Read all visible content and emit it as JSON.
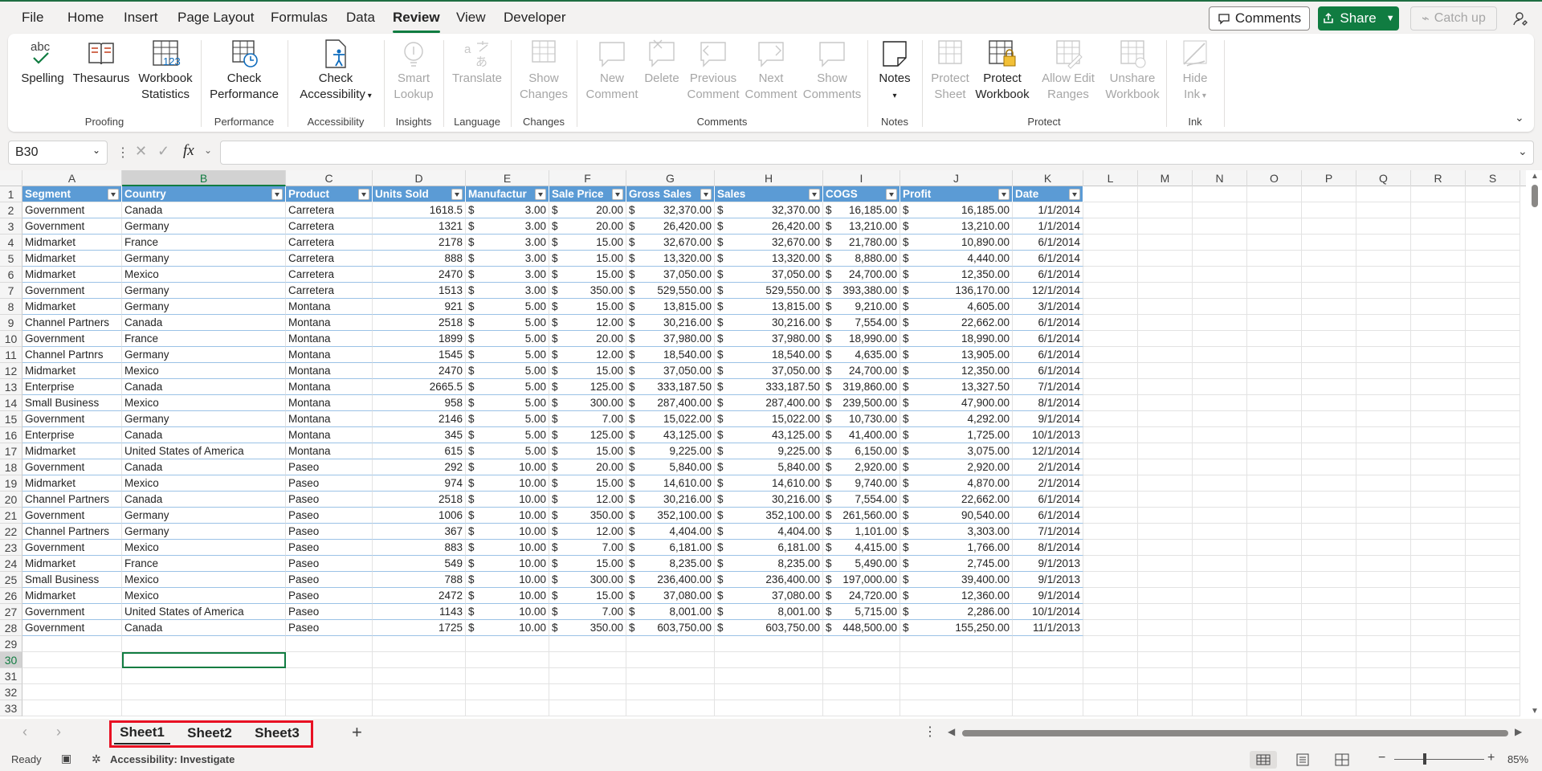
{
  "menu": {
    "tabs": [
      "File",
      "Home",
      "Insert",
      "Page Layout",
      "Formulas",
      "Data",
      "Review",
      "View",
      "Developer"
    ],
    "active": "Review",
    "comments_label": "Comments",
    "share_label": "Share",
    "catchup_label": "Catch up"
  },
  "ribbon": {
    "spelling": "Spelling",
    "thesaurus": "Thesaurus",
    "workbook": "Workbook",
    "statistics": "Statistics",
    "check": "Check",
    "performance": "Performance",
    "check2": "Check",
    "accessibility": "Accessibility",
    "smart": "Smart",
    "lookup": "Lookup",
    "translate": "Translate",
    "show": "Show",
    "changes": "Changes",
    "new": "New",
    "comment": "Comment",
    "delete": "Delete",
    "previous": "Previous",
    "comment2": "Comment",
    "next": "Next",
    "comment3": "Comment",
    "show2": "Show",
    "comments": "Comments",
    "notes": "Notes",
    "protect": "Protect",
    "sheet": "Sheet",
    "protect2": "Protect",
    "workbook2": "Workbook",
    "allowedit": "Allow Edit",
    "ranges": "Ranges",
    "unshare": "Unshare",
    "workbook3": "Workbook",
    "hide": "Hide",
    "ink": "Ink",
    "groups": [
      "Proofing",
      "Performance",
      "Accessibility",
      "Insights",
      "Language",
      "Changes",
      "Comments",
      "Notes",
      "Protect",
      "Ink"
    ]
  },
  "formula_bar": {
    "name_box": "B30",
    "formula": ""
  },
  "columns": [
    "A",
    "B",
    "C",
    "D",
    "E",
    "F",
    "G",
    "H",
    "I",
    "J",
    "K",
    "L",
    "M",
    "N",
    "O",
    "P",
    "Q",
    "R",
    "S"
  ],
  "table": {
    "headers": [
      "Segment",
      "Country",
      "Product",
      "Units Sold",
      "Manufactur",
      "Sale Price",
      "Gross Sales",
      "Sales",
      "COGS",
      "Profit",
      "Date"
    ],
    "rows": [
      [
        "Government",
        "Canada",
        "Carretera",
        "1618.5",
        "3.00",
        "20.00",
        "32,370.00",
        "32,370.00",
        "16,185.00",
        "16,185.00",
        "1/1/2014"
      ],
      [
        "Government",
        "Germany",
        "Carretera",
        "1321",
        "3.00",
        "20.00",
        "26,420.00",
        "26,420.00",
        "13,210.00",
        "13,210.00",
        "1/1/2014"
      ],
      [
        "Midmarket",
        "France",
        "Carretera",
        "2178",
        "3.00",
        "15.00",
        "32,670.00",
        "32,670.00",
        "21,780.00",
        "10,890.00",
        "6/1/2014"
      ],
      [
        "Midmarket",
        "Germany",
        "Carretera",
        "888",
        "3.00",
        "15.00",
        "13,320.00",
        "13,320.00",
        "8,880.00",
        "4,440.00",
        "6/1/2014"
      ],
      [
        "Midmarket",
        "Mexico",
        "Carretera",
        "2470",
        "3.00",
        "15.00",
        "37,050.00",
        "37,050.00",
        "24,700.00",
        "12,350.00",
        "6/1/2014"
      ],
      [
        "Government",
        "Germany",
        "Carretera",
        "1513",
        "3.00",
        "350.00",
        "529,550.00",
        "529,550.00",
        "393,380.00",
        "136,170.00",
        "12/1/2014"
      ],
      [
        "Midmarket",
        "Germany",
        "Montana",
        "921",
        "5.00",
        "15.00",
        "13,815.00",
        "13,815.00",
        "9,210.00",
        "4,605.00",
        "3/1/2014"
      ],
      [
        "Channel Partners",
        "Canada",
        "Montana",
        "2518",
        "5.00",
        "12.00",
        "30,216.00",
        "30,216.00",
        "7,554.00",
        "22,662.00",
        "6/1/2014"
      ],
      [
        "Government",
        "France",
        "Montana",
        "1899",
        "5.00",
        "20.00",
        "37,980.00",
        "37,980.00",
        "18,990.00",
        "18,990.00",
        "6/1/2014"
      ],
      [
        "Channel Partnrs",
        "Germany",
        "Montana",
        "1545",
        "5.00",
        "12.00",
        "18,540.00",
        "18,540.00",
        "4,635.00",
        "13,905.00",
        "6/1/2014"
      ],
      [
        "Midmarket",
        "Mexico",
        "Montana",
        "2470",
        "5.00",
        "15.00",
        "37,050.00",
        "37,050.00",
        "24,700.00",
        "12,350.00",
        "6/1/2014"
      ],
      [
        "Enterprise",
        "Canada",
        "Montana",
        "2665.5",
        "5.00",
        "125.00",
        "333,187.50",
        "333,187.50",
        "319,860.00",
        "13,327.50",
        "7/1/2014"
      ],
      [
        "Small Business",
        "Mexico",
        "Montana",
        "958",
        "5.00",
        "300.00",
        "287,400.00",
        "287,400.00",
        "239,500.00",
        "47,900.00",
        "8/1/2014"
      ],
      [
        "Government",
        "Germany",
        "Montana",
        "2146",
        "5.00",
        "7.00",
        "15,022.00",
        "15,022.00",
        "10,730.00",
        "4,292.00",
        "9/1/2014"
      ],
      [
        "Enterprise",
        "Canada",
        "Montana",
        "345",
        "5.00",
        "125.00",
        "43,125.00",
        "43,125.00",
        "41,400.00",
        "1,725.00",
        "10/1/2013"
      ],
      [
        "Midmarket",
        "United States of America",
        "Montana",
        "615",
        "5.00",
        "15.00",
        "9,225.00",
        "9,225.00",
        "6,150.00",
        "3,075.00",
        "12/1/2014"
      ],
      [
        "Government",
        "Canada",
        "Paseo",
        "292",
        "10.00",
        "20.00",
        "5,840.00",
        "5,840.00",
        "2,920.00",
        "2,920.00",
        "2/1/2014"
      ],
      [
        "Midmarket",
        "Mexico",
        "Paseo",
        "974",
        "10.00",
        "15.00",
        "14,610.00",
        "14,610.00",
        "9,740.00",
        "4,870.00",
        "2/1/2014"
      ],
      [
        "Channel Partners",
        "Canada",
        "Paseo",
        "2518",
        "10.00",
        "12.00",
        "30,216.00",
        "30,216.00",
        "7,554.00",
        "22,662.00",
        "6/1/2014"
      ],
      [
        "Government",
        "Germany",
        "Paseo",
        "1006",
        "10.00",
        "350.00",
        "352,100.00",
        "352,100.00",
        "261,560.00",
        "90,540.00",
        "6/1/2014"
      ],
      [
        "Channel Partners",
        "Germany",
        "Paseo",
        "367",
        "10.00",
        "12.00",
        "4,404.00",
        "4,404.00",
        "1,101.00",
        "3,303.00",
        "7/1/2014"
      ],
      [
        "Government",
        "Mexico",
        "Paseo",
        "883",
        "10.00",
        "7.00",
        "6,181.00",
        "6,181.00",
        "4,415.00",
        "1,766.00",
        "8/1/2014"
      ],
      [
        "Midmarket",
        "France",
        "Paseo",
        "549",
        "10.00",
        "15.00",
        "8,235.00",
        "8,235.00",
        "5,490.00",
        "2,745.00",
        "9/1/2013"
      ],
      [
        "Small Business",
        "Mexico",
        "Paseo",
        "788",
        "10.00",
        "300.00",
        "236,400.00",
        "236,400.00",
        "197,000.00",
        "39,400.00",
        "9/1/2013"
      ],
      [
        "Midmarket",
        "Mexico",
        "Paseo",
        "2472",
        "10.00",
        "15.00",
        "37,080.00",
        "37,080.00",
        "24,720.00",
        "12,360.00",
        "9/1/2014"
      ],
      [
        "Government",
        "United States of America",
        "Paseo",
        "1143",
        "10.00",
        "7.00",
        "8,001.00",
        "8,001.00",
        "5,715.00",
        "2,286.00",
        "10/1/2014"
      ],
      [
        "Government",
        "Canada",
        "Paseo",
        "1725",
        "10.00",
        "350.00",
        "603,750.00",
        "603,750.00",
        "448,500.00",
        "155,250.00",
        "11/1/2013"
      ]
    ]
  },
  "row_count": 33,
  "selected": {
    "row": 30,
    "col": "B"
  },
  "sheets": [
    "Sheet1",
    "Sheet2",
    "Sheet3"
  ],
  "active_sheet": "Sheet1",
  "status": {
    "ready": "Ready",
    "accessibility": "Accessibility: Investigate",
    "zoom": "85%"
  },
  "colors": {
    "accent": "#107c41",
    "table_header": "#5b9bd5",
    "highlight": "#e81123"
  }
}
